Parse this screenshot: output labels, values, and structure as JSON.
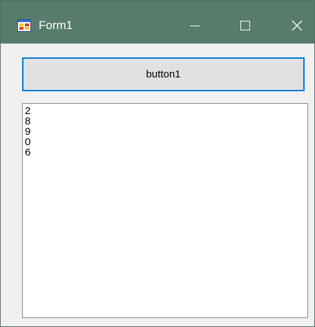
{
  "window": {
    "title": "Form1"
  },
  "titlebar": {
    "icon": "winforms-app-icon",
    "minimize_icon": "minimize-icon",
    "maximize_icon": "maximize-icon",
    "close_icon": "close-icon"
  },
  "form": {
    "button1_label": "button1",
    "listbox_items": [
      "2",
      "8",
      "9",
      "0",
      "6"
    ]
  },
  "colors": {
    "titlebar": "#587c6c",
    "client_background": "#f0f0f0",
    "button_background": "#e1e1e1",
    "button_focus_border": "#0078d7",
    "listbox_border": "#828790"
  }
}
